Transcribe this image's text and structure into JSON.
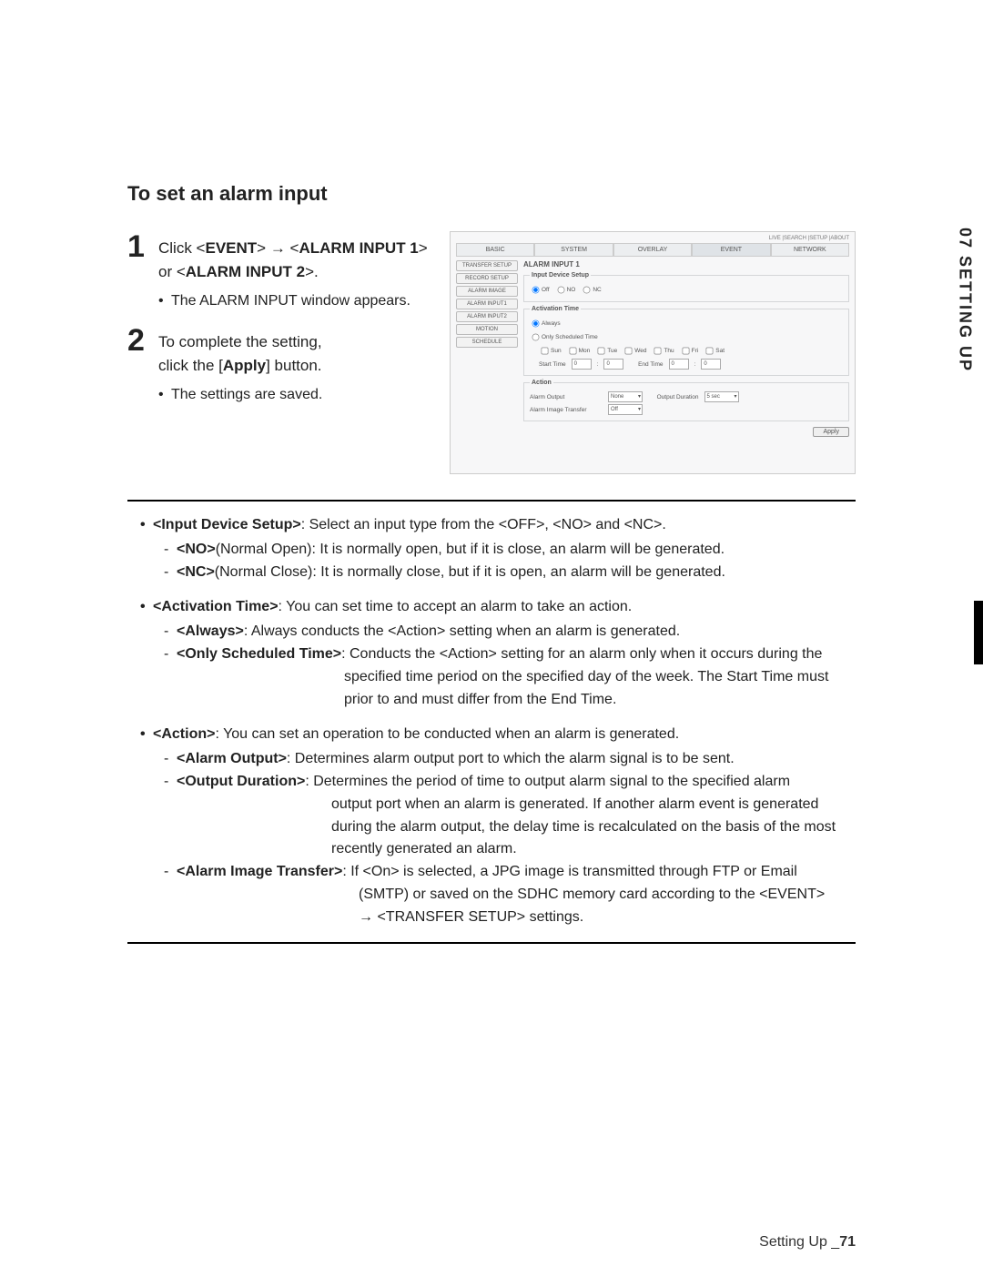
{
  "side_tab": {
    "label": "07 SETTING UP"
  },
  "section_title": "To set an alarm input",
  "steps": [
    {
      "num": "1",
      "pre": "Click <",
      "b1": "EVENT",
      "mid1": "> ",
      "arrow": "→",
      "mid2": " <",
      "b2": "ALARM INPUT 1",
      "post1": "> or <",
      "b3": "ALARM INPUT 2",
      "post2": ">.",
      "sub": "The ALARM INPUT window appears."
    },
    {
      "num": "2",
      "line1a": "To complete the setting,",
      "line2a": "click the [",
      "line2b": "Apply",
      "line2c": "] button.",
      "sub": "The settings are saved."
    }
  ],
  "screenshot": {
    "toplinks": "LIVE  |SEARCH |SETUP  |ABOUT",
    "tabs": [
      "BASIC",
      "SYSTEM",
      "OVERLAY",
      "EVENT",
      "NETWORK"
    ],
    "active_tab": 3,
    "sidebar": [
      "TRANSFER SETUP",
      "RECORD SETUP",
      "ALARM IMAGE",
      "ALARM INPUT1",
      "ALARM INPUT2",
      "MOTION",
      "SCHEDULE"
    ],
    "panel_title": "ALARM INPUT 1",
    "input_device": {
      "legend": "Input Device Setup",
      "opts": [
        "Off",
        "NO",
        "NC"
      ],
      "selected": 0
    },
    "activation": {
      "legend": "Activation Time",
      "always": "Always",
      "sched": "Only Scheduled Time",
      "selected": "always",
      "days": [
        "Sun",
        "Mon",
        "Tue",
        "Wed",
        "Thu",
        "Fri",
        "Sat"
      ],
      "start_label": "Start Time",
      "end_label": "End Time",
      "start_h": "0",
      "start_m": "0",
      "end_h": "0",
      "end_m": "0"
    },
    "action": {
      "legend": "Action",
      "alarm_output_label": "Alarm Output",
      "alarm_output_value": "None",
      "output_duration_label": "Output Duration",
      "output_duration_value": "5 sec",
      "alarm_image_transfer_label": "Alarm Image Transfer",
      "alarm_image_transfer_value": "Off"
    },
    "apply_label": "Apply"
  },
  "notes": {
    "input_device": {
      "head_a": "<Input Device Setup>",
      "head_b": ": Select an input type from the <OFF>, <NO> and <NC>.",
      "no_a": "<NO>",
      "no_b": "(Normal Open): It is normally open, but if it is close, an alarm will be generated.",
      "nc_a": "<NC>",
      "nc_b": "(Normal Close): It is normally close, but if it is open, an alarm will be generated."
    },
    "activation": {
      "head_a": "<Activation Time>",
      "head_b": ": You can set time to accept an alarm to take an action.",
      "always_a": "<Always>",
      "always_b": ": Always conducts the <Action> setting when an alarm is generated.",
      "sched_a": "<Only Scheduled Time>",
      "sched_b": ": Conducts the <Action> setting for an alarm only when it occurs during the",
      "sched_c1": "specified time period on the specified day of the week. The Start Time must",
      "sched_c2": "prior to and must differ from the End Time."
    },
    "action": {
      "head_a": "<Action>",
      "head_b": ": You can set an operation to be conducted when an alarm is generated.",
      "ao_a": "<Alarm Output>",
      "ao_b": ": Determines alarm output port to which the alarm signal is to be sent.",
      "od_a": "<Output Duration>",
      "od_b": ": Determines the period of time to output alarm signal to the specified alarm",
      "od_c1": "output port when an alarm is generated. If another alarm event is generated",
      "od_c2": "during the alarm output, the delay time is recalculated on the basis of the most",
      "od_c3": "recently generated an alarm.",
      "ait_a": "<Alarm Image Transfer>",
      "ait_b": ": If <On> is selected, a JPG image is transmitted through FTP or Email",
      "ait_c1": "(SMTP) or saved on the SDHC memory card according to the <EVENT>",
      "ait_arrow": "→",
      "ait_c2": " <TRANSFER SETUP> settings."
    }
  },
  "footer": {
    "label": "Setting Up _",
    "page": "71"
  }
}
